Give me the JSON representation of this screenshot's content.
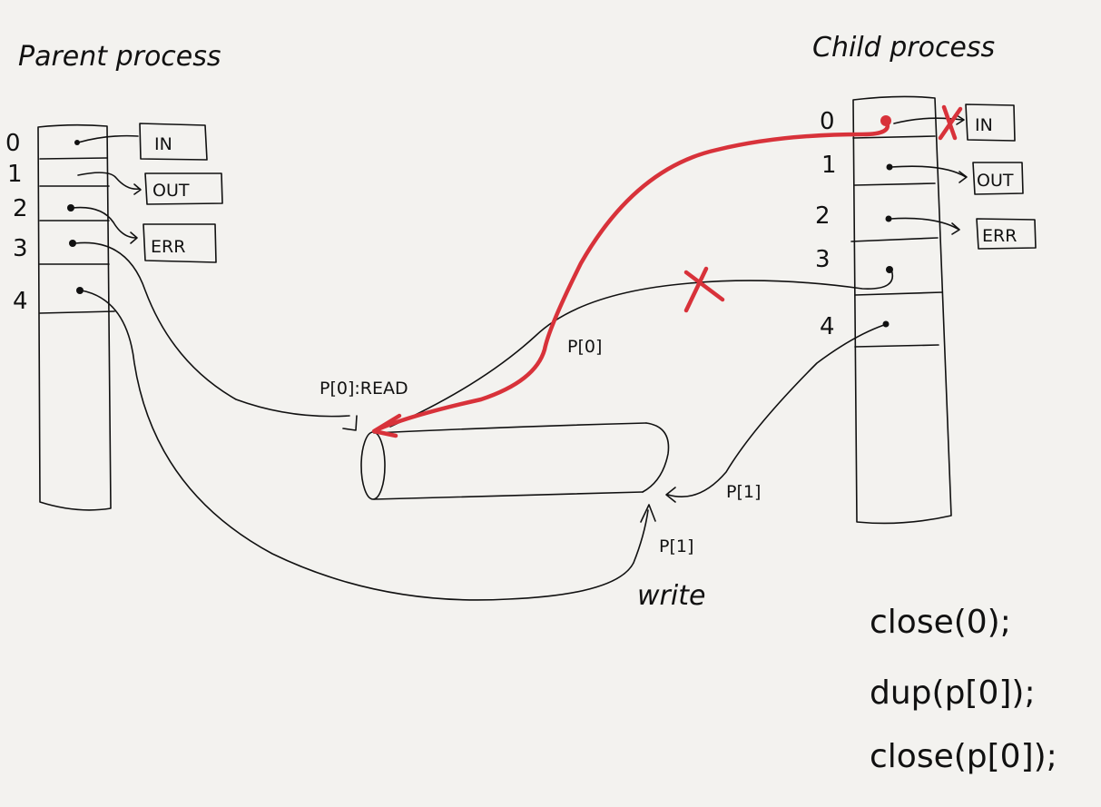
{
  "parent": {
    "title": "Parent process",
    "indices": [
      "0",
      "1",
      "2",
      "3",
      "4"
    ]
  },
  "child": {
    "title": "Child process",
    "indices": [
      "0",
      "1",
      "2",
      "3",
      "4"
    ]
  },
  "streams": {
    "in": "IN",
    "out": "OUT",
    "err": "ERR"
  },
  "pipe": {
    "read_label": "P[0]:READ",
    "p0_label": "P[0]",
    "p1_child_label": "P[1]",
    "p1_parent_label": "P[1]",
    "write_label": "write"
  },
  "code": {
    "line1": "close(0);",
    "line2": "dup(p[0]);",
    "line3": "close(p[0]);"
  },
  "colors": {
    "ink": "#111111",
    "highlight": "#d8323a",
    "paper": "#f3f2ef"
  }
}
